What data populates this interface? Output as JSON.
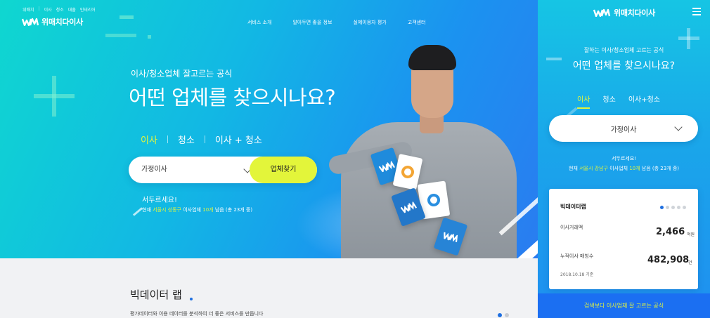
{
  "desktop": {
    "util_links": [
      "위매치",
      "이사",
      "청소",
      "대출",
      "인테리어"
    ],
    "brand": {
      "name": "위매치다이사"
    },
    "gnb": [
      "서비스 소개",
      "알아두면 좋을 정보",
      "실제이용자 평가",
      "고객센터"
    ],
    "hero": {
      "sub_title": "이사/청소업체 잘고르는 공식",
      "main_title": "어떤 업체를 찾으시나요?",
      "tabs": [
        "이사",
        "청소",
        "이사 + 청소"
      ],
      "active_tab": "이사",
      "select_value": "가정이사",
      "search_button": "업체찾기",
      "hurry_text": "서두르세요!",
      "status": {
        "prefix": "현재",
        "location": "서울시 성동구",
        "middle": "이사업체",
        "count": "10개",
        "suffix": "남음 (총 23개 중)"
      }
    },
    "bigdata": {
      "title": "빅데이터 랩",
      "description": "평가데이터와 이용 데이터를 분석하여 더 좋은 서비스를 만듭니다"
    }
  },
  "mobile": {
    "brand": {
      "name": "위매치다이사"
    },
    "sub_title": "잘하는 이사/청소업체 고르는 공식",
    "main_title": "어떤 업체를 찾으시나요?",
    "tabs": [
      "이사",
      "청소",
      "이사+청소"
    ],
    "active_tab": "이사",
    "select_value": "가정이사",
    "hurry_text": "서두르세요!",
    "status": {
      "prefix": "현재",
      "location": "서울시 강남구",
      "middle": "이사업체",
      "count": "10개",
      "suffix": "남음 (총 23개 중)"
    },
    "bigdata_card": {
      "title": "빅데이터랩",
      "stats": [
        {
          "label": "이사거래액",
          "value": "2,466",
          "unit": "억원"
        },
        {
          "label": "누적이사 매칭수",
          "value": "482,908",
          "unit": "건"
        }
      ],
      "date": "2018.10.18 기준"
    },
    "footer_cta": "검색보다 이사업체 잘 고르는 공식"
  },
  "colors": {
    "accent_yellow": "#e4f53b",
    "brand_blue": "#1f6fe0",
    "hero_start": "#0fd7d0",
    "hero_end": "#2a7cf0"
  }
}
